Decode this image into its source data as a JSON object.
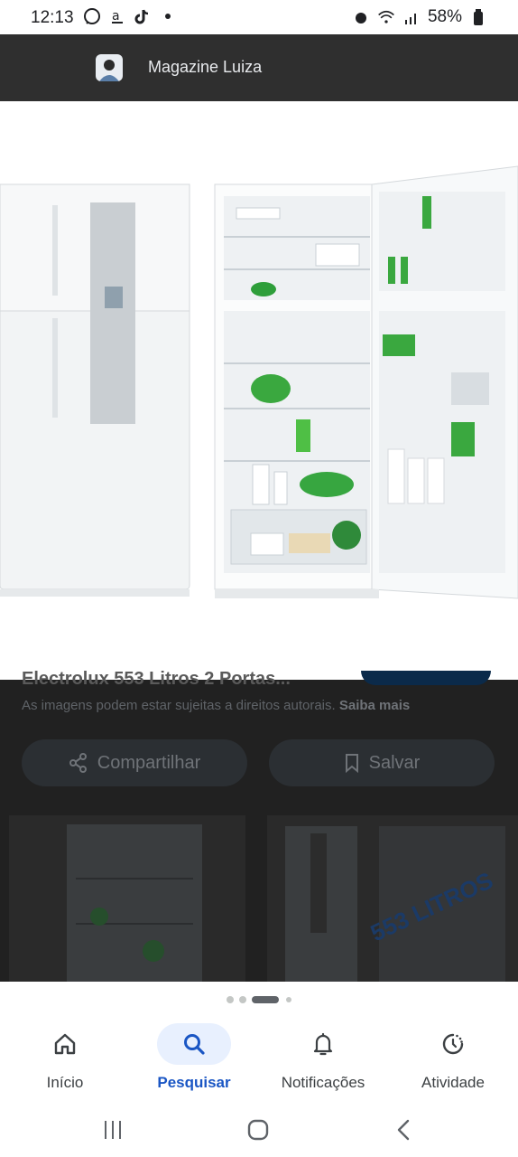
{
  "status_bar": {
    "time": "12:13",
    "battery": "58%",
    "left_icons": [
      "whatsapp-icon",
      "amazon-icon",
      "tiktok-icon",
      "dot-icon"
    ],
    "right_icons": [
      "alarm-icon",
      "wifi-icon",
      "signal-icon",
      "battery-icon"
    ]
  },
  "header": {
    "source_title": "Magazine Luiza"
  },
  "content": {
    "partial_title": "Electrolux 553 Litros 2 Portas...",
    "rights_notice": "As imagens podem estar sujeitas a direitos autorais.",
    "learn_more": "Saiba mais",
    "share_label": "Compartilhar",
    "save_label": "Salvar",
    "thumbnail_text": "553 LITROS"
  },
  "carousel": {
    "pages": 4,
    "active_index": 2
  },
  "bottom_nav": {
    "items": [
      {
        "label": "Início",
        "icon": "home-icon",
        "active": false
      },
      {
        "label": "Pesquisar",
        "icon": "search-icon",
        "active": true
      },
      {
        "label": "Notificações",
        "icon": "bell-icon",
        "active": false
      },
      {
        "label": "Atividade",
        "icon": "activity-icon",
        "active": false
      }
    ]
  },
  "system_nav": {
    "buttons": [
      "recents-icon",
      "home-button-icon",
      "back-icon"
    ]
  },
  "colors": {
    "accent": "#1a56c4",
    "active_pill": "#e8f0fe",
    "header_bg": "#2f2f2f"
  }
}
